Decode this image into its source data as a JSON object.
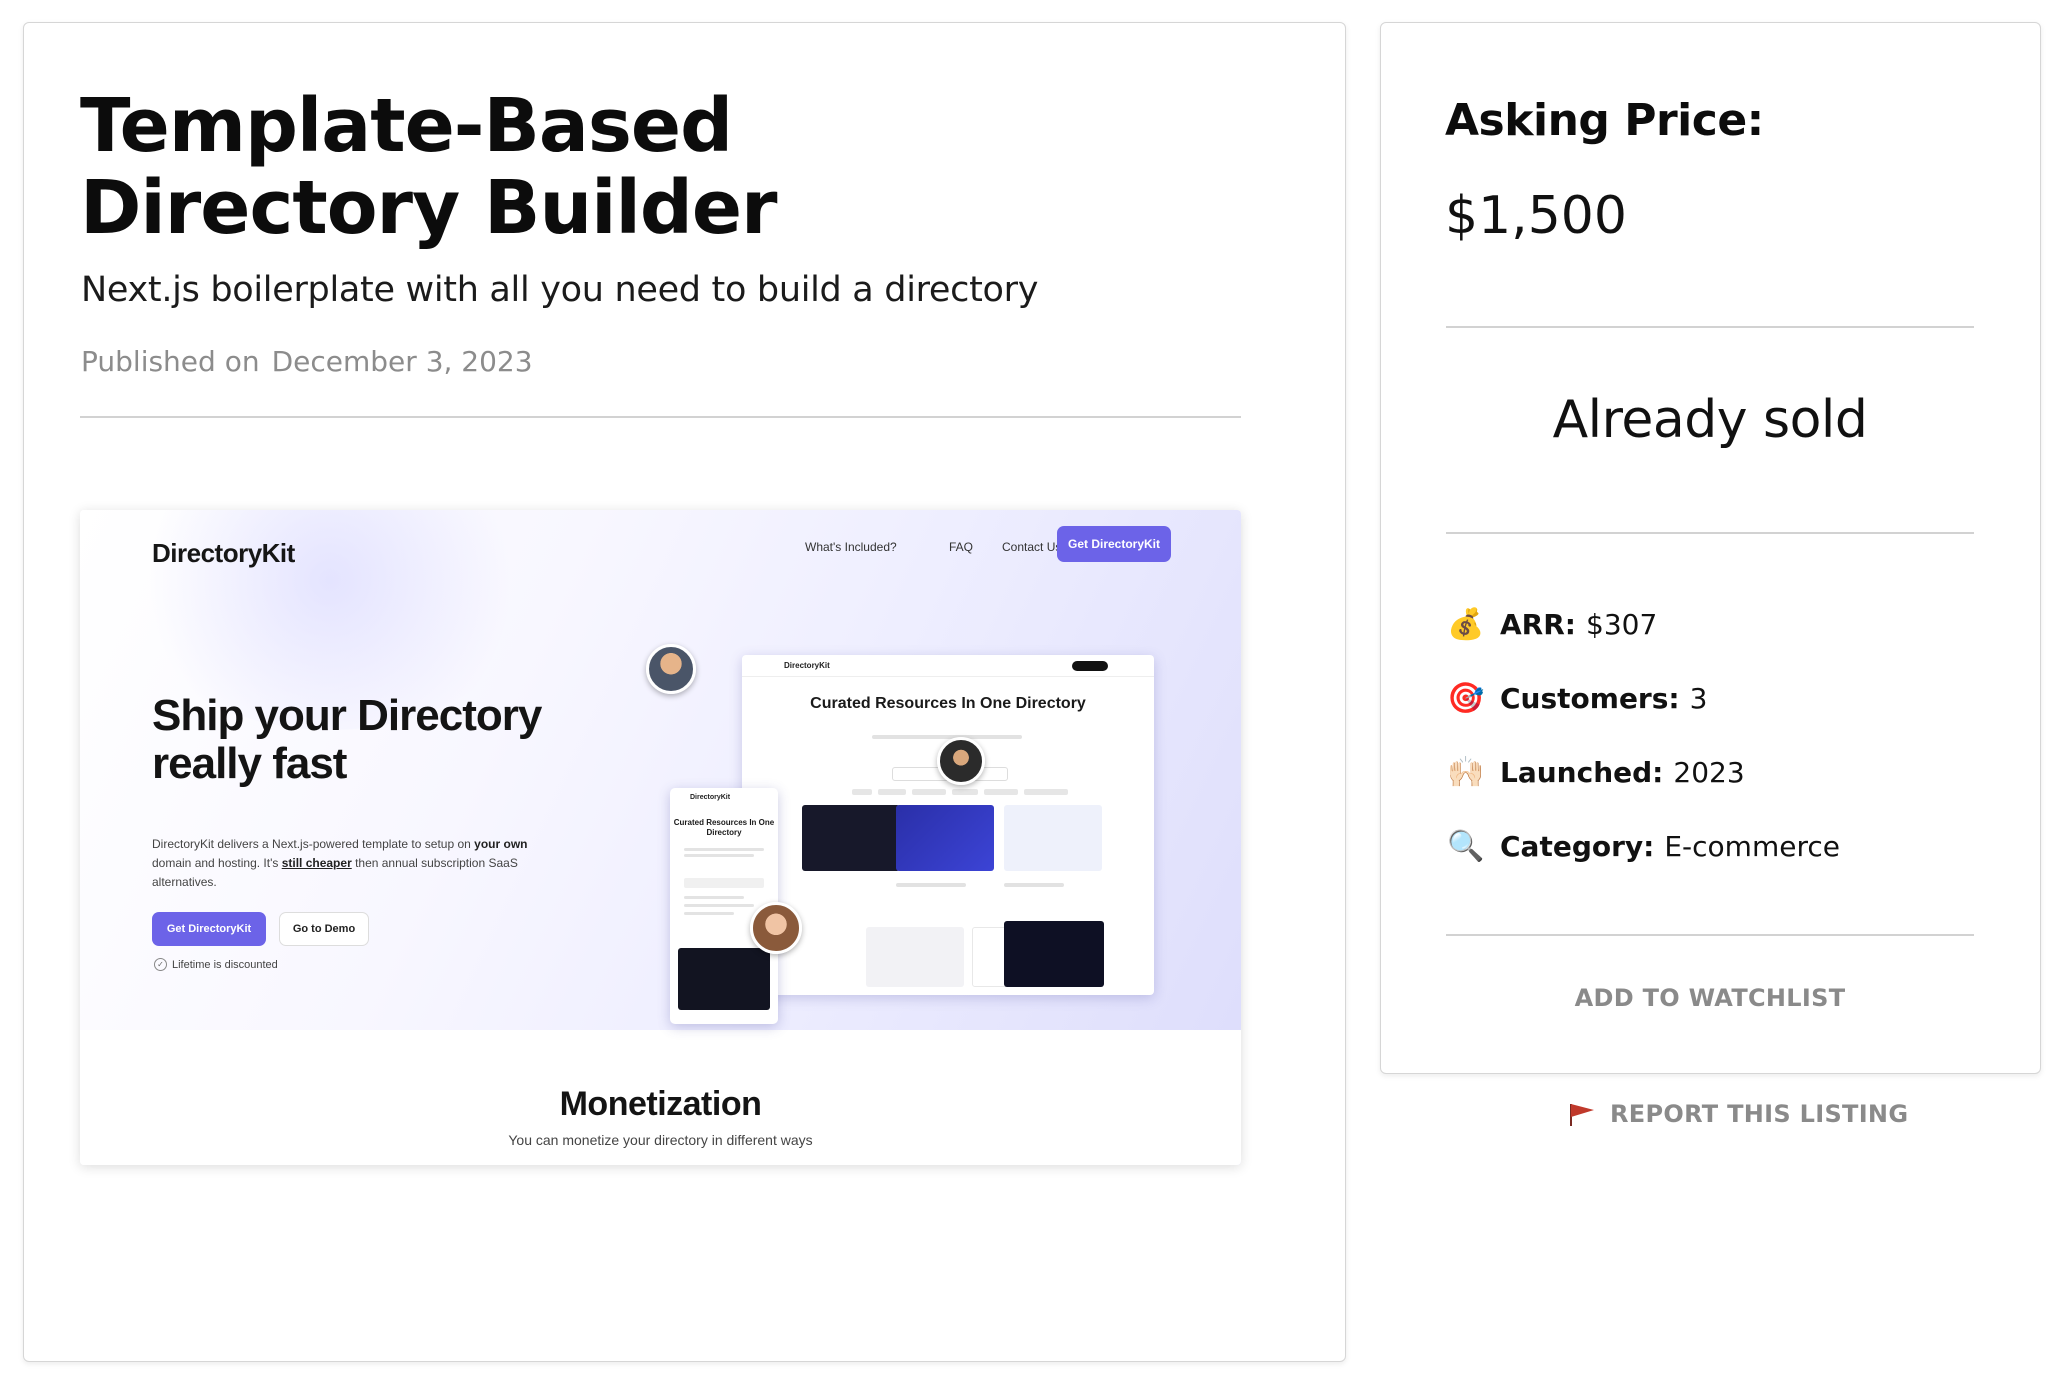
{
  "listing": {
    "title": "Template-Based Directory Builder",
    "subtitle": "Next.js boilerplate with all you need to build a directory",
    "published_label": "Published on",
    "published_date": "December 3, 2023"
  },
  "preview": {
    "logo": "DirectoryKit",
    "nav": [
      "What's Included?",
      "FAQ",
      "Contact Us"
    ],
    "nav_cta": "Get DirectoryKit",
    "headline": "Ship your Directory really fast",
    "description_parts": {
      "p1": "DirectoryKit delivers a Next.js-powered template to setup on ",
      "p2": "your own",
      "p3": " domain and hosting. It's ",
      "p4": "still cheaper",
      "p5": " then annual subscription SaaS alternatives."
    },
    "primary_button": "Get DirectoryKit",
    "secondary_button": "Go to Demo",
    "discount_note": "Lifetime is discounted",
    "mock_desktop_logo": "DirectoryKit",
    "mock_desktop_title": "Curated Resources In One Directory",
    "mock_phone_logo": "DirectoryKit",
    "mock_phone_title": "Curated Resources In One Directory",
    "section_title": "Monetization",
    "section_subtitle": "You can monetize your directory in different ways"
  },
  "sidebar": {
    "asking_label": "Asking Price:",
    "asking_value": "$1,500",
    "status": "Already sold",
    "stats": [
      {
        "icon": "money-bag-icon",
        "glyph": "💰",
        "label": "ARR:",
        "value": "$307"
      },
      {
        "icon": "target-icon",
        "glyph": "🎯",
        "label": "Customers:",
        "value": "3"
      },
      {
        "icon": "raised-hands-icon",
        "glyph": "🙌🏻",
        "label": "Launched:",
        "value": "2023"
      },
      {
        "icon": "magnifier-icon",
        "glyph": "🔍",
        "label": "Category:",
        "value": "E-commerce"
      }
    ],
    "watchlist_label": "ADD TO WATCHLIST",
    "report_label": "REPORT THIS LISTING"
  },
  "colors": {
    "accent": "#6c63e8",
    "muted_text": "#8a8a8a",
    "divider": "#d2d2d2",
    "flag": "#c0392b"
  }
}
